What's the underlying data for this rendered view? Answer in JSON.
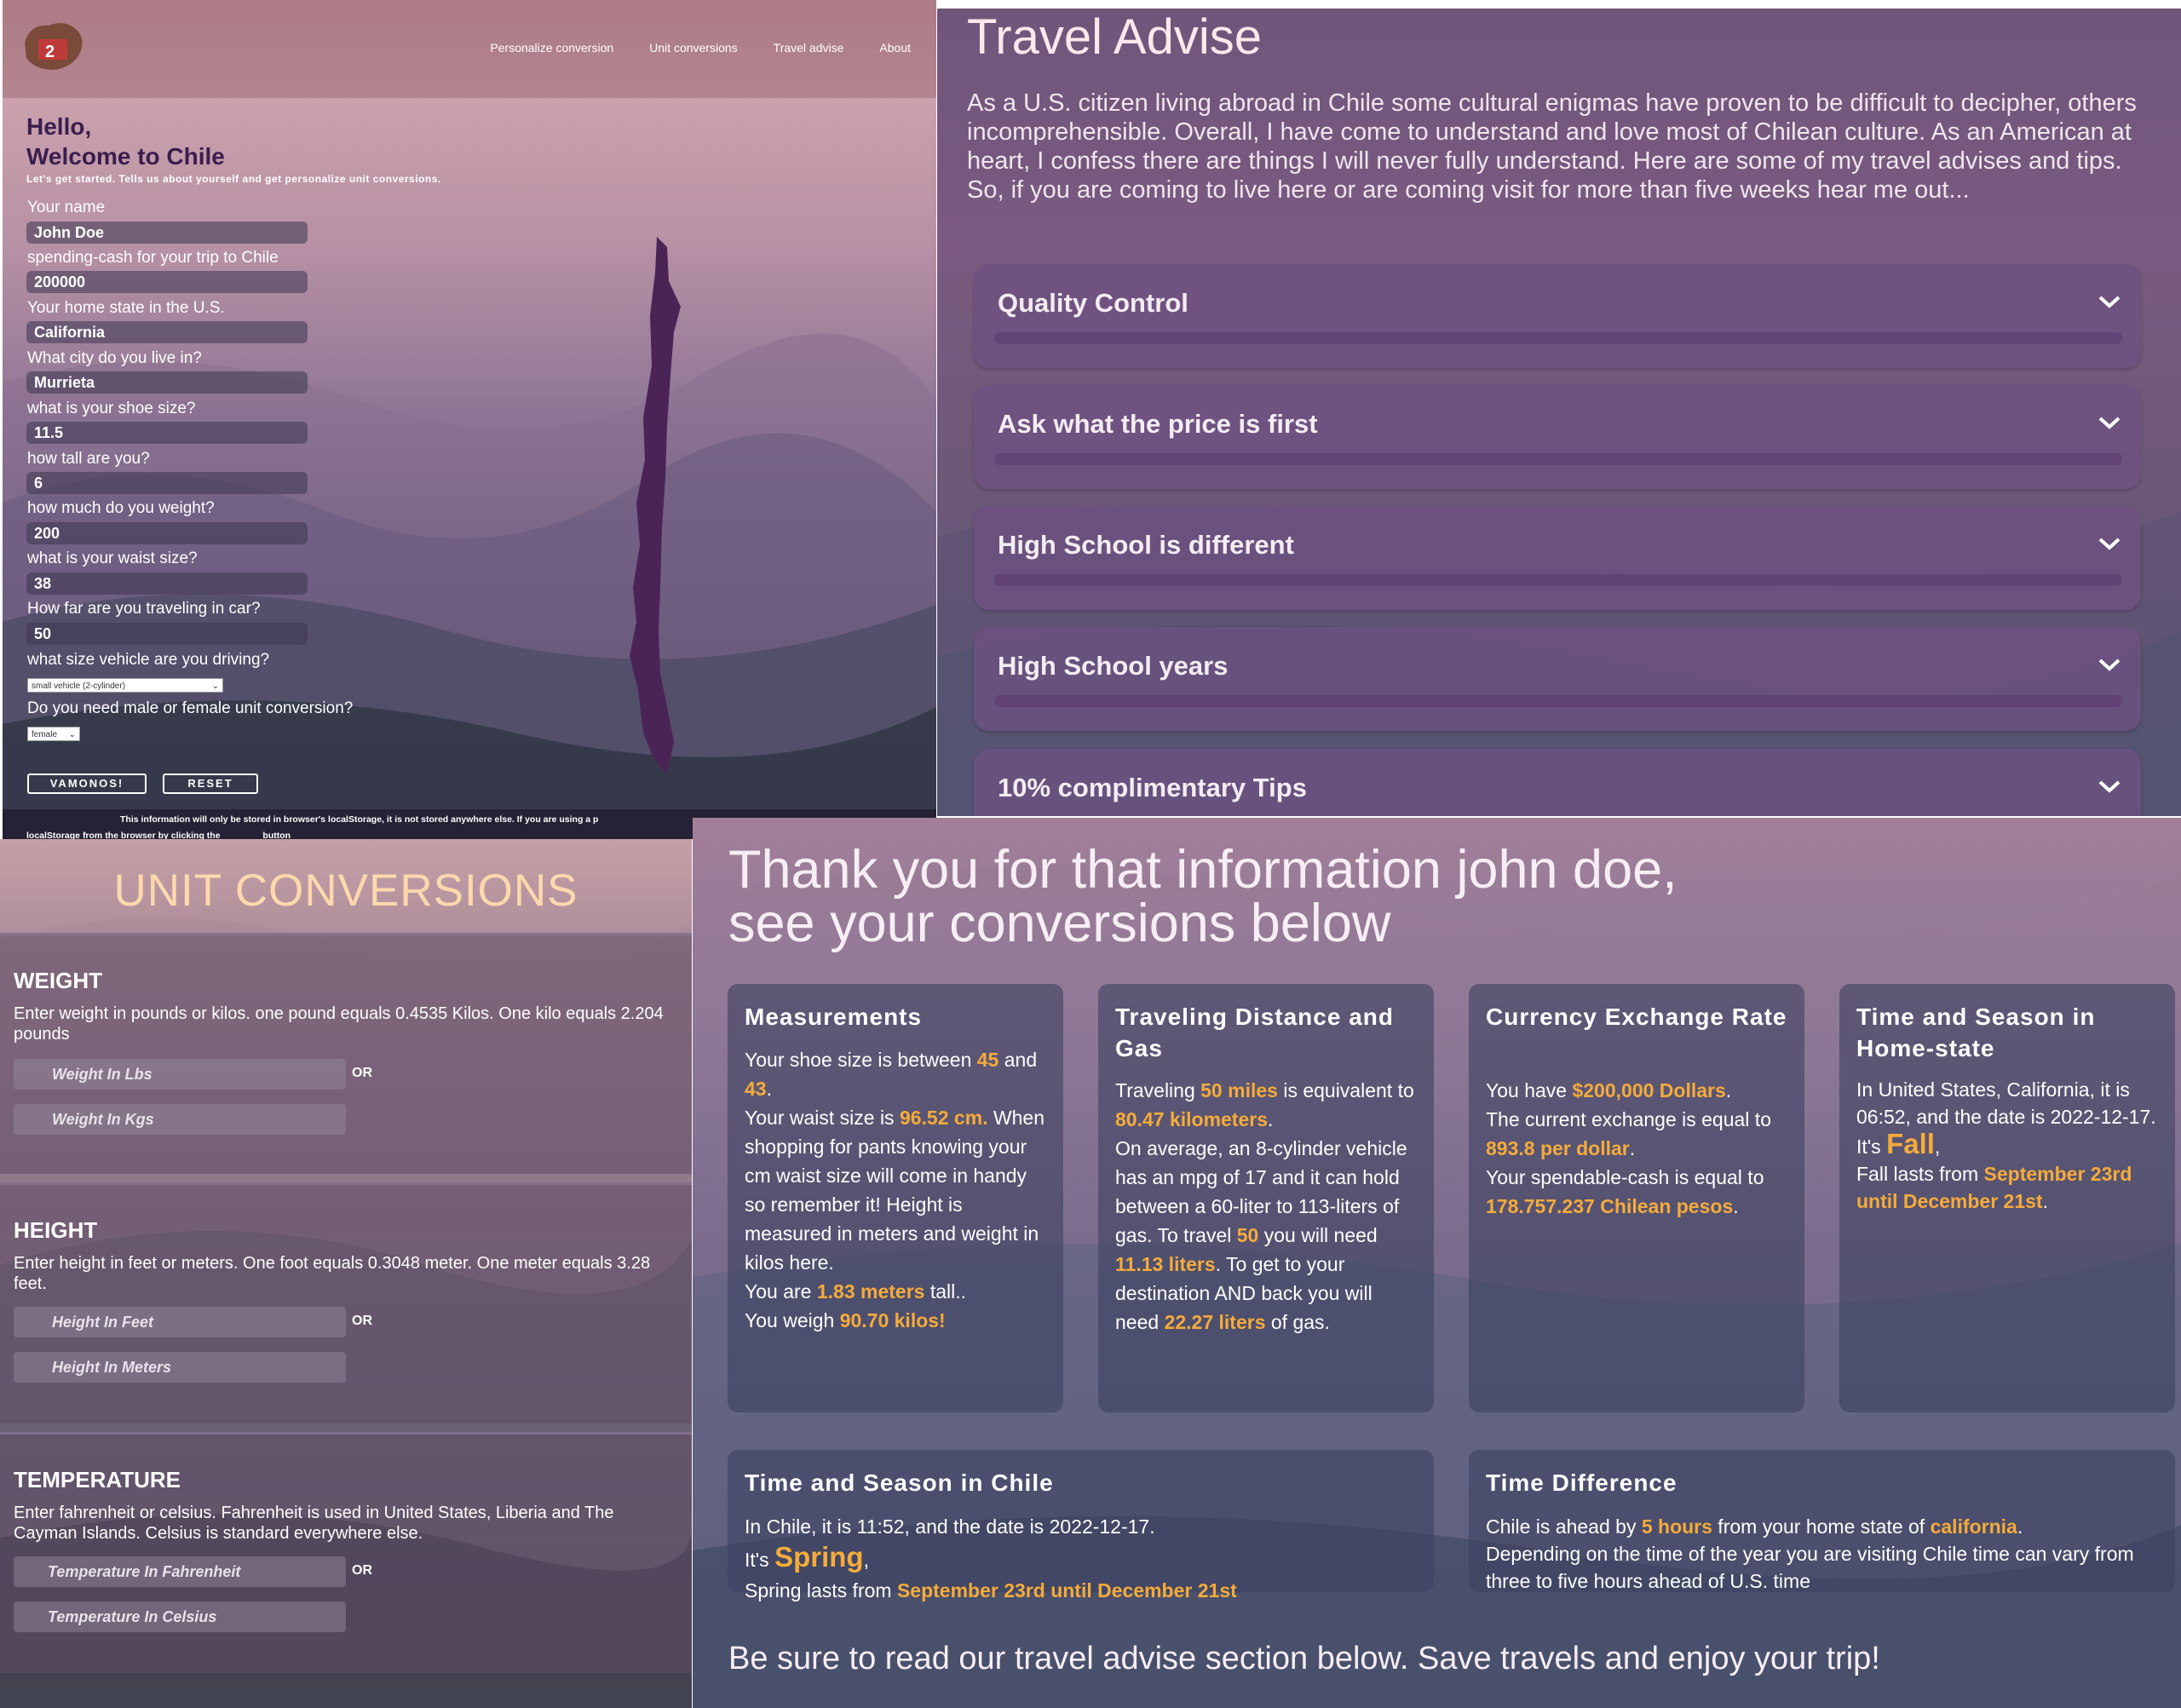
{
  "colors": {
    "accent": "#f5ab3b",
    "heading_peach": "#fcd9ad",
    "greeting": "#3b1d4e"
  },
  "form": {
    "nav": [
      "Personalize conversion",
      "Unit conversions",
      "Travel advise",
      "About"
    ],
    "hello": "Hello,",
    "welcome": "Welcome to Chile",
    "subtitle": "Let's get started. Tells us about yourself and get personalize unit conversions.",
    "fields": [
      {
        "label": "Your name",
        "value": "John Doe"
      },
      {
        "label": "spending-cash for your trip to Chile",
        "value": "200000"
      },
      {
        "label": "Your home state in the U.S.",
        "value": "California"
      },
      {
        "label": "What city do you live in?",
        "value": "Murrieta"
      },
      {
        "label": "what is your shoe size?",
        "value": "11.5"
      },
      {
        "label": "how tall are you?",
        "value": "6"
      },
      {
        "label": "how much do you weight?",
        "value": "200"
      },
      {
        "label": "what is your waist size?",
        "value": "38"
      },
      {
        "label": "How far are you traveling in car?",
        "value": "50"
      }
    ],
    "vehicle_label": "what size vehicle are you driving?",
    "vehicle_value": "small vehicle (2-cylinder)",
    "gender_label": "Do you need male or female unit conversion?",
    "gender_value": "female",
    "btn_go": "VAMONOS!",
    "btn_reset": "RESET",
    "note_line1": "This information will only be stored in browser's localStorage, it is not stored anywhere else. If you are using a p",
    "note_line2_a": "localStorage from the browser by clicking the",
    "note_line2_b": "button"
  },
  "advise": {
    "title": "Travel Advise",
    "intro": "As a U.S. citizen living abroad in Chile some cultural enigmas have proven to be difficult to decipher, others incomprehensible. Overall, I have come to understand and love most of Chilean culture. As an American at heart, I confess there are things I will never fully understand. Here are some of my travel advises and tips. So, if you are coming to live here or are coming visit for more than five weeks hear me out...",
    "items": [
      "Quality Control",
      "Ask what the price is first",
      "High School is different",
      "High School years",
      "10% complimentary Tips"
    ]
  },
  "units": {
    "title": "UNIT CONVERSIONS",
    "or": "OR",
    "weight": {
      "heading": "WEIGHT",
      "desc": "Enter weight in pounds or kilos. one pound equals 0.4535 Kilos. One kilo equals 2.204 pounds",
      "ph1": "Weight In Lbs",
      "ph2": "Weight In Kgs"
    },
    "height": {
      "heading": "HEIGHT",
      "desc": "Enter height in feet or meters. One foot equals 0.3048 meter. One meter equals 3.28 feet.",
      "ph1": "Height In Feet",
      "ph2": "Height In Meters"
    },
    "temperature": {
      "heading": "TEMPERATURE",
      "desc": "Enter fahrenheit or celsius. Fahrenheit is used in United States, Liberia and The Cayman Islands. Celsius is standard everywhere else.",
      "ph1": "Temperature In Fahrenheit",
      "ph2": "Temperature In Celsius"
    }
  },
  "results": {
    "thank1": "Thank you for that information john doe,",
    "thank2": "see your conversions below",
    "footer": "Be sure to read our travel advise section below. Save travels and enjoy your trip!",
    "measurements": {
      "title": "Measurements",
      "t1": "Your shoe size is between ",
      "v1": "45",
      "t2": " and ",
      "v2": "43",
      "t3": ".",
      "t4": "Your waist size is ",
      "v3": "96.52 cm.",
      "t5": " When shopping for pants knowing your cm waist size will come in handy so remember it! Height is measured in meters and weight in kilos here.",
      "t6": "You are ",
      "v4": "1.83 meters",
      "t7": " tall..",
      "t8": "You weigh ",
      "v5": "90.70 kilos!"
    },
    "distance": {
      "title": "Traveling Distance and Gas",
      "t1": "Traveling ",
      "v1": "50 miles",
      "t2": " is equivalent to ",
      "v2": "80.47 kilometers",
      "t3": ".",
      "t4": "On average, an 8-cylinder vehicle has an mpg of 17 and it can hold between a 60-liter to 113-liters of gas. To travel ",
      "v3": "50",
      "t5": " you will need ",
      "v4": "11.13 liters",
      "t6": ". To get to your destination AND back you will need ",
      "v5": "22.27 liters",
      "t7": " of gas."
    },
    "currency": {
      "title": "Currency Exchange Rate",
      "t1": "You have ",
      "v1": "$200,000 Dollars",
      "t2": ".",
      "t3": "The current exchange is equal to ",
      "v2": "893.8 per dollar",
      "t4": ".",
      "t5": "Your spendable-cash is equal to ",
      "v3": "178.757.237 Chilean pesos",
      "t6": "."
    },
    "home_time": {
      "title": "Time and Season in Home-state",
      "t1": "In United States, California, it is 06:52, and the date is 2022-12-17.",
      "t2": "It's ",
      "v1": "Fall",
      "t3": ",",
      "t4": "Fall lasts from ",
      "v2": "September 23rd until December 21st",
      "t5": "."
    },
    "chile_time": {
      "title": "Time and Season in Chile",
      "t1": "In Chile, it is 11:52, and the date is 2022-12-17.",
      "t2": "It's ",
      "v1": "Spring",
      "t3": ",",
      "t4": "Spring lasts from ",
      "v2": "September 23rd until December 21st"
    },
    "difference": {
      "title": "Time Difference",
      "t1": "Chile is ahead by ",
      "v1": "5 hours",
      "t2": " from your home state of ",
      "v2": "california",
      "t3": ".",
      "t4": "Depending on the time of the year you are visiting Chile time can vary from three to five hours ahead of U.S. time"
    }
  }
}
